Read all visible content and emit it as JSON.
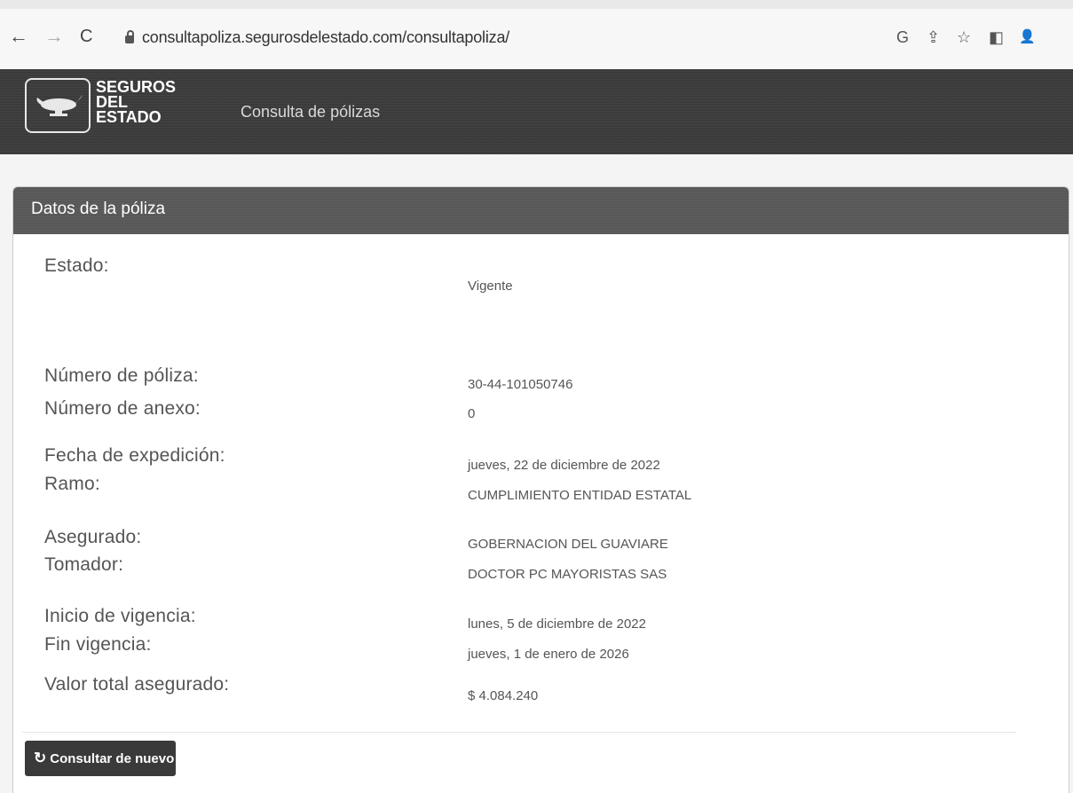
{
  "browser": {
    "url": "consultapoliza.segurosdelestado.com/consultapoliza/",
    "back_icon": "←",
    "forward_icon": "→",
    "reload_icon": "C",
    "right_icons": [
      "G",
      "⇪",
      "☆",
      "◧",
      "👤"
    ]
  },
  "header": {
    "logo_line1": "SEGUROS",
    "logo_line2": "DEL",
    "logo_line3": "ESTADO",
    "nav_title": "Consulta de pólizas"
  },
  "panel": {
    "title": "Datos de la póliza",
    "fields": [
      {
        "label": "Estado:",
        "value": "Vigente"
      },
      {
        "label": "Número de póliza:",
        "value": "30-44-101050746"
      },
      {
        "label": "Número de anexo:",
        "value": "0"
      },
      {
        "label": "Fecha de expedición:",
        "value": "jueves, 22 de diciembre de 2022"
      },
      {
        "label": "Ramo:",
        "value": "CUMPLIMIENTO ENTIDAD ESTATAL"
      },
      {
        "label": "Asegurado:",
        "value": "GOBERNACION DEL GUAVIARE"
      },
      {
        "label": "Tomador:",
        "value": "DOCTOR PC MAYORISTAS SAS"
      },
      {
        "label": "Inicio de vigencia:",
        "value": "lunes, 5 de diciembre de 2022"
      },
      {
        "label": "Fin vigencia:",
        "value": "jueves, 1 de enero de 2026"
      },
      {
        "label": "Valor total asegurado:",
        "value": "$ 4.084.240"
      }
    ],
    "button_label": "Consultar de nuevo",
    "button_icon": "↻"
  },
  "colors": {
    "header_bg": "#3b3b3b",
    "panel_heading_bg": "#5c5c5c",
    "button_bg": "#3a3a3a"
  }
}
